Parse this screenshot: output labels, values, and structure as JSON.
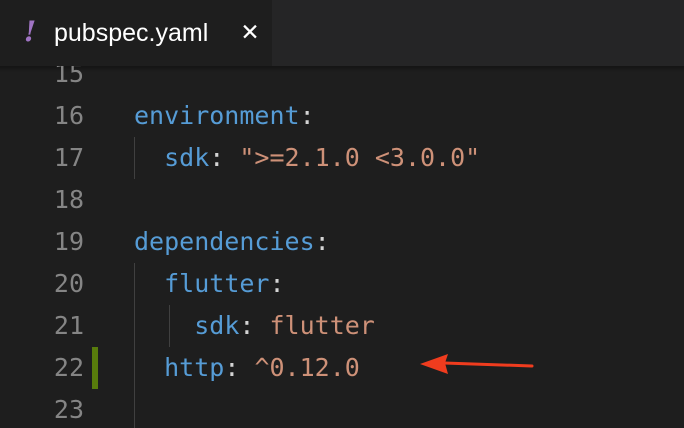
{
  "tab": {
    "icon": "!",
    "icon_name": "yaml-exclamation-icon",
    "title": "pubspec.yaml",
    "close": "✕"
  },
  "editor": {
    "lines": [
      {
        "number": "15",
        "indent": "",
        "key": "",
        "sep": "",
        "value": ""
      },
      {
        "number": "16",
        "indent": "",
        "key": "environment",
        "sep": ":",
        "value": ""
      },
      {
        "number": "17",
        "indent": "  ",
        "key": "sdk",
        "sep": ": ",
        "value": "\">=2.1.0 <3.0.0\""
      },
      {
        "number": "18",
        "indent": "",
        "key": "",
        "sep": "",
        "value": ""
      },
      {
        "number": "19",
        "indent": "",
        "key": "dependencies",
        "sep": ":",
        "value": ""
      },
      {
        "number": "20",
        "indent": "  ",
        "key": "flutter",
        "sep": ":",
        "value": ""
      },
      {
        "number": "21",
        "indent": "    ",
        "key": "sdk",
        "sep": ": ",
        "value": "flutter"
      },
      {
        "number": "22",
        "indent": "  ",
        "key": "http",
        "sep": ": ",
        "value": "^0.12.0"
      },
      {
        "number": "23",
        "indent": "",
        "key": "",
        "sep": "",
        "value": ""
      }
    ],
    "modified_line": "22"
  },
  "annotation": {
    "arrow_name": "red-arrow-icon",
    "color": "#f03c1e"
  },
  "colors": {
    "background": "#1e1e1e",
    "key": "#569cd6",
    "string": "#ce9178",
    "line_number": "#858585",
    "modified_gutter": "#587c0c"
  }
}
